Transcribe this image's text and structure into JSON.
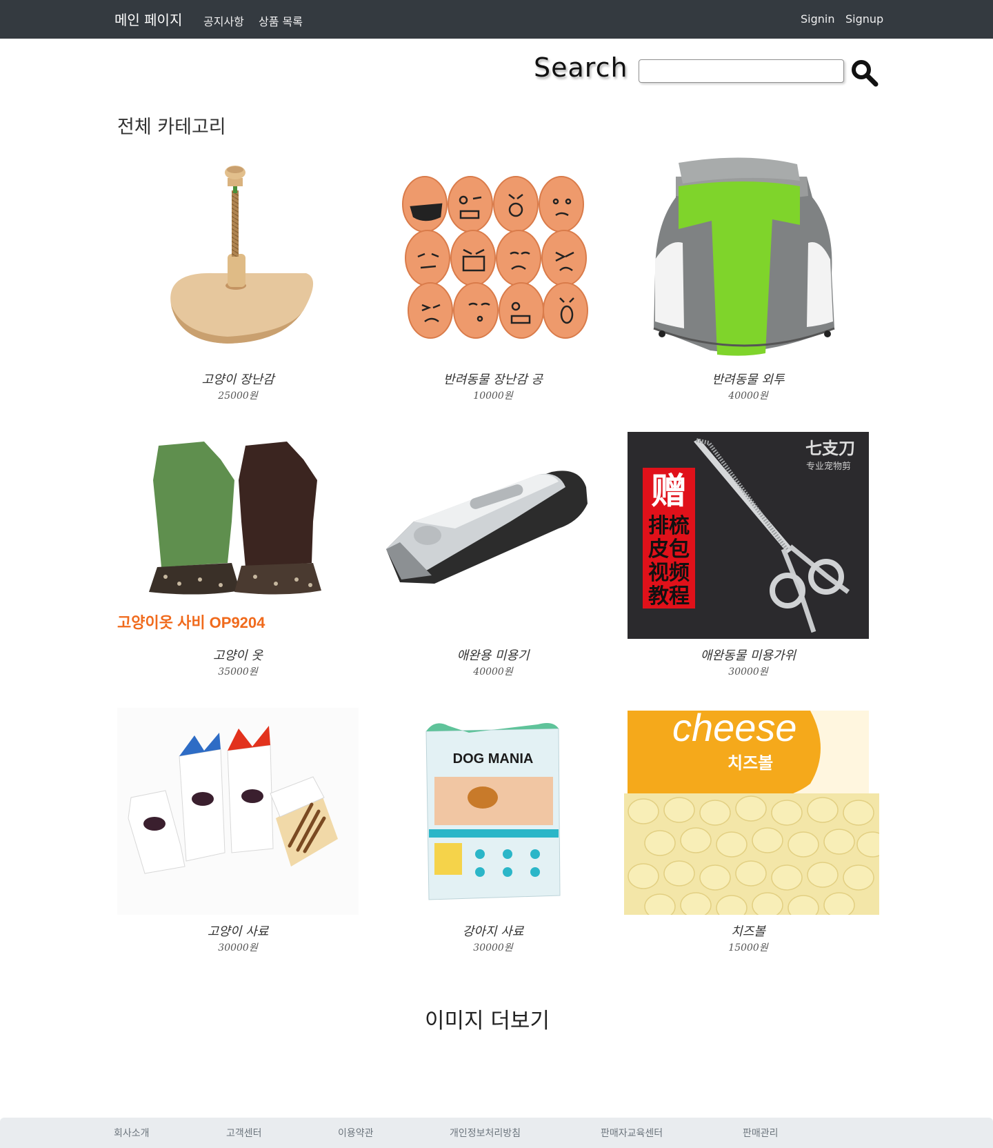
{
  "navbar": {
    "brand": "메인 페이지",
    "links": [
      "공지사항",
      "상품 목록"
    ],
    "signin": "Signin",
    "signup": "Signup"
  },
  "search": {
    "label": "Search",
    "value": "",
    "icon": "search-icon"
  },
  "category_title": "전체 카테고리",
  "products": [
    {
      "name": "고양이 장난감",
      "price": "25000원"
    },
    {
      "name": "반려동물 장난감 공",
      "price": "10000원"
    },
    {
      "name": "반려동물 외투",
      "price": "40000원"
    },
    {
      "name": "고양이 옷",
      "price": "35000원",
      "image_text": "고양이옷 사비 OP9204"
    },
    {
      "name": "애완용 미용기",
      "price": "40000원"
    },
    {
      "name": "애완동물 미용가위",
      "price": "30000원",
      "image_text_brand": "七支刀",
      "image_text_sub": "专业宠物剪",
      "image_text_gift": [
        "赠",
        "排梳",
        "皮包",
        "视频",
        "教程"
      ]
    },
    {
      "name": "고양이 사료",
      "price": "30000원"
    },
    {
      "name": "강아지 사료",
      "price": "30000원",
      "image_text": "DOG MANIA"
    },
    {
      "name": "치즈볼",
      "price": "15000원",
      "image_text": "cheese",
      "image_text_sub": "치즈볼"
    }
  ],
  "more_images": "이미지 더보기",
  "footer": {
    "links": [
      "회사소개",
      "고객센터",
      "이용약관",
      "개인정보처리방침",
      "판매자교육센터",
      "판매관리"
    ]
  },
  "colors": {
    "navbar_bg": "#343a40",
    "footer_bg": "#e9ecef",
    "page_bg": "#ffffff"
  }
}
